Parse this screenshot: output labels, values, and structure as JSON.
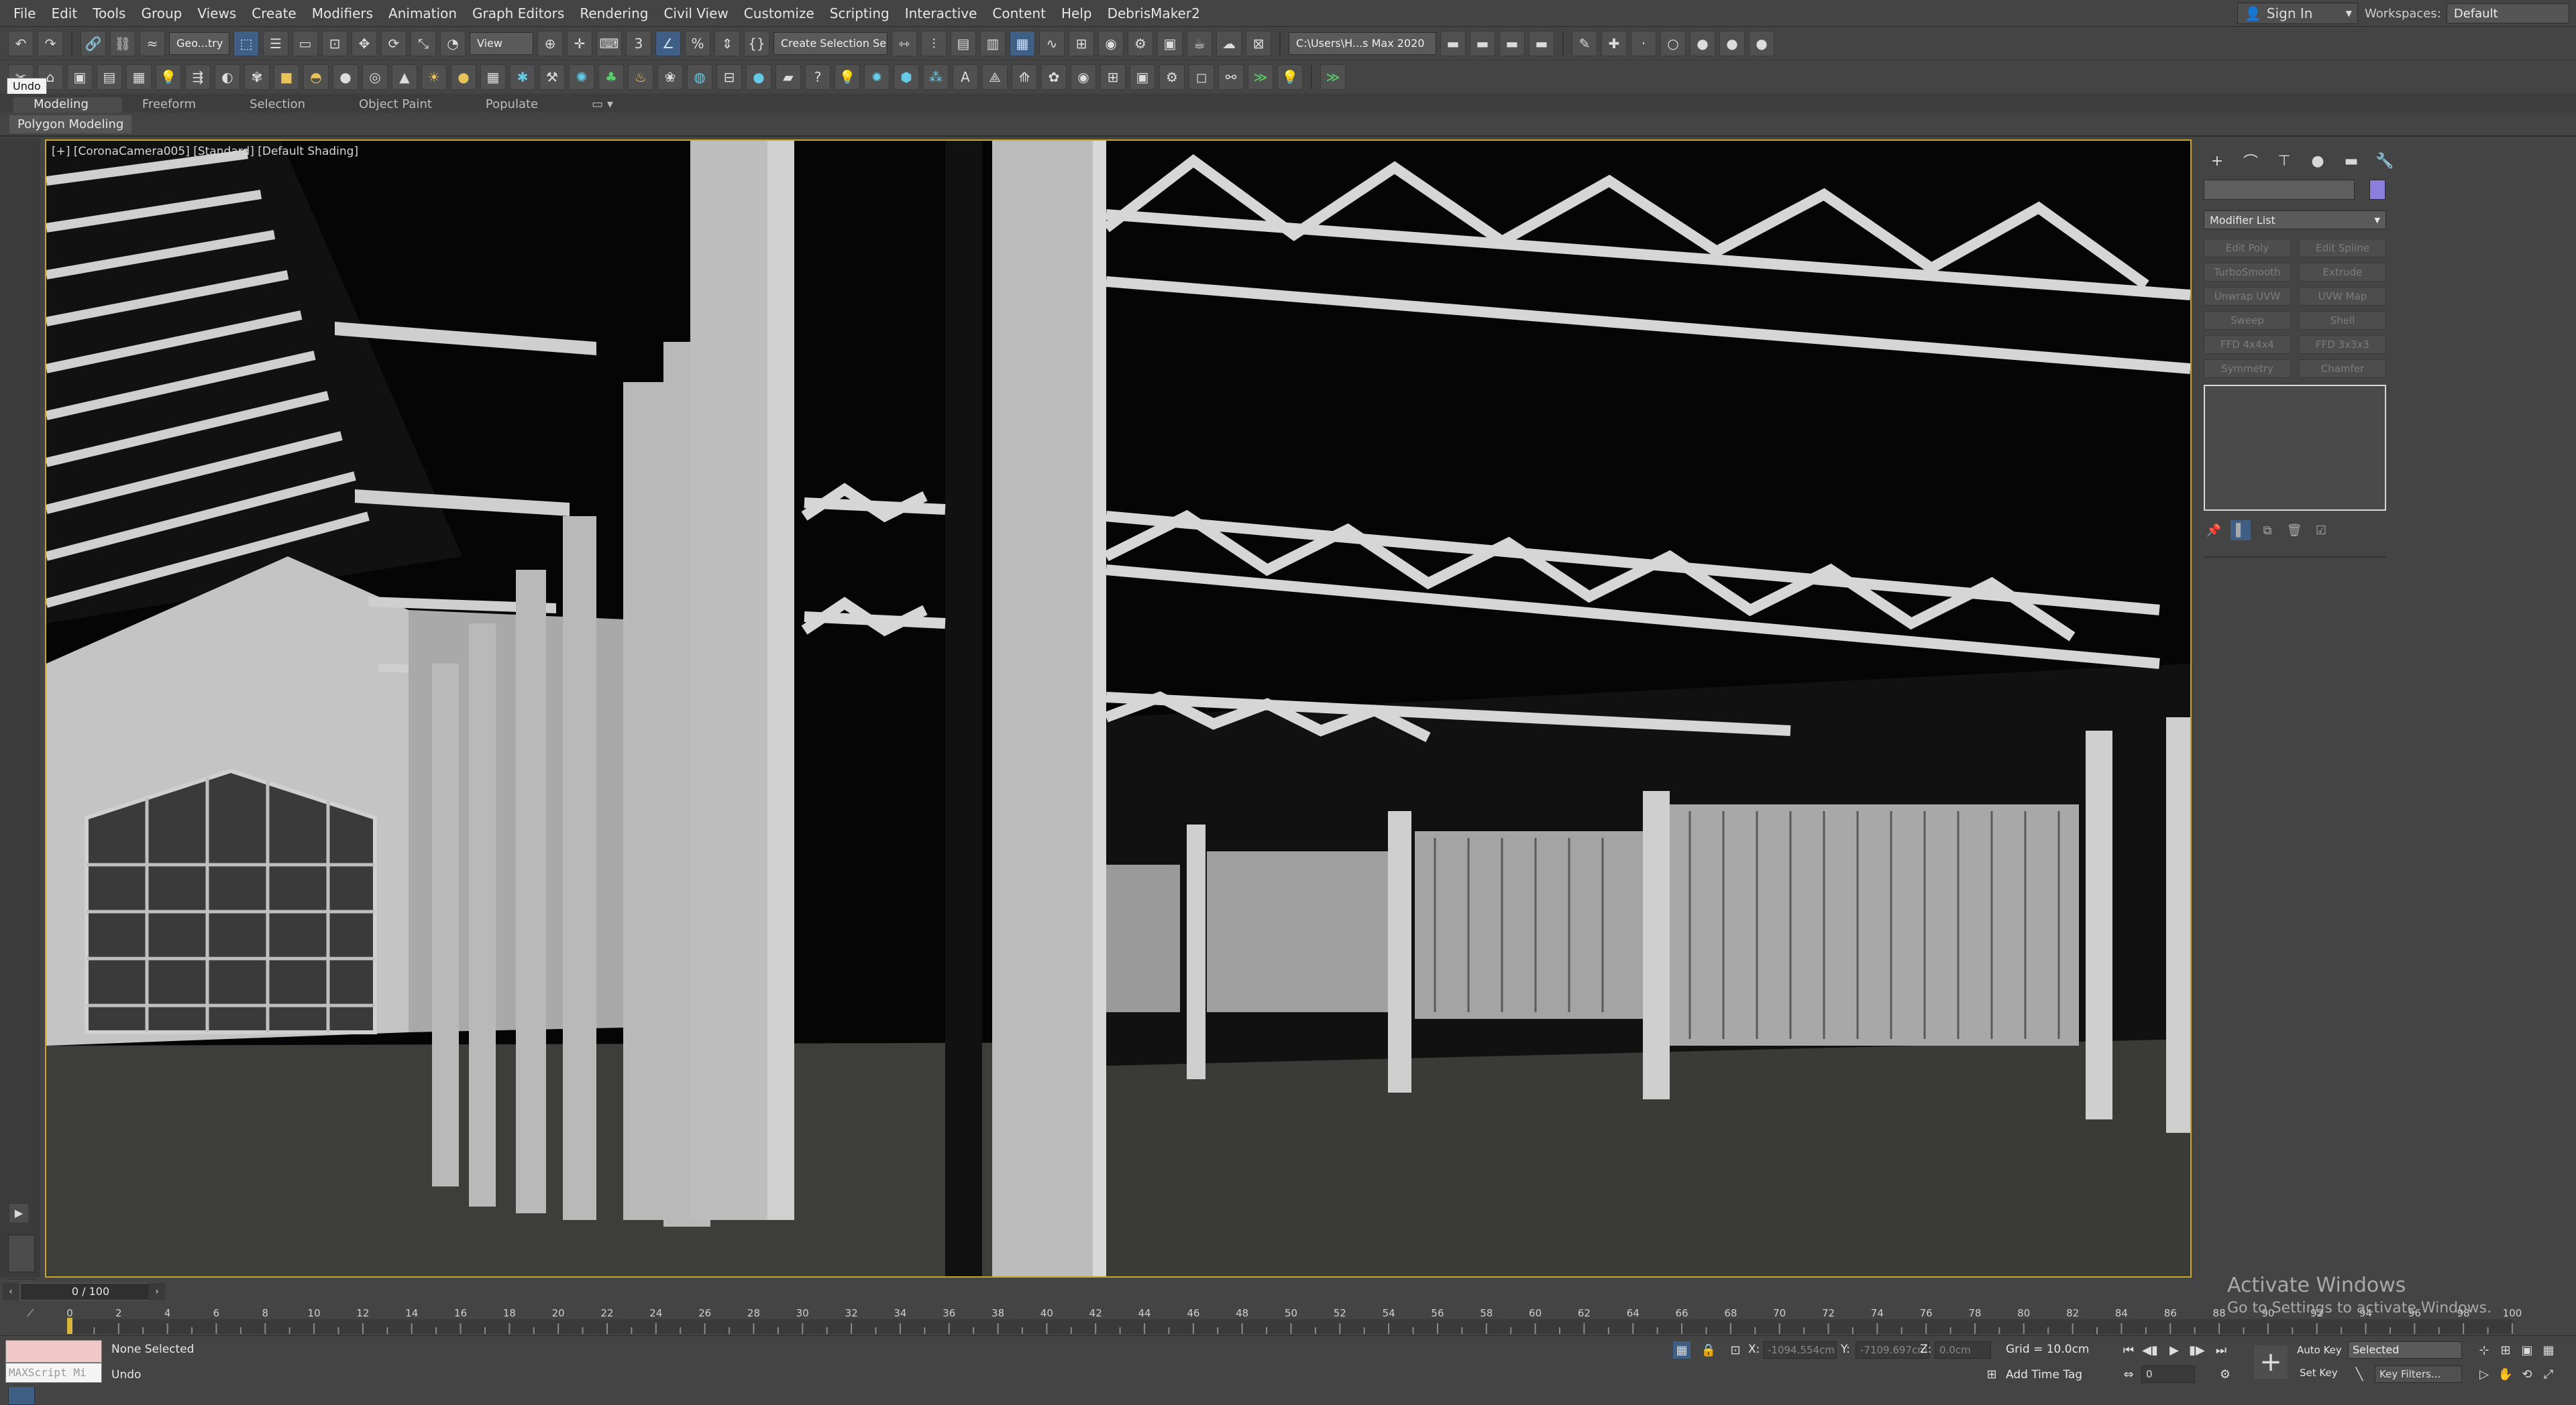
{
  "menu": [
    "File",
    "Edit",
    "Tools",
    "Group",
    "Views",
    "Create",
    "Modifiers",
    "Animation",
    "Graph Editors",
    "Rendering",
    "Civil View",
    "Customize",
    "Scripting",
    "Interactive",
    "Content",
    "Help",
    "DebrisMaker2"
  ],
  "account": {
    "signin_label": "Sign In",
    "workspaces_label": "Workspaces:",
    "workspace_value": "Default"
  },
  "toolbar": {
    "selection_filter": "Geo...try",
    "ref_coord": "View",
    "named_selection": "Create Selection Se",
    "project_path": "C:\\Users\\H...s Max 2020"
  },
  "tooltip": "Undo",
  "ribbon": {
    "tabs": [
      "Modeling",
      "Freeform",
      "Selection",
      "Object Paint",
      "Populate"
    ],
    "active_tab": "Modeling",
    "panel_label": "Polygon Modeling"
  },
  "viewport": {
    "label": "[+] [CoronaCamera005] [Standard] [Default Shading]"
  },
  "command_panel": {
    "modifier_list_label": "Modifier List",
    "color_swatch": "#8a7fdc",
    "modifier_buttons": [
      "Edit Poly",
      "Edit Spline",
      "TurboSmooth",
      "Extrude",
      "Unwrap UVW",
      "UVW Map",
      "Sweep",
      "Shell",
      "FFD 4x4x4",
      "FFD 3x3x3",
      "Symmetry",
      "Chamfer"
    ]
  },
  "timeline": {
    "frame_display": "0 / 100",
    "ticks": [
      0,
      2,
      4,
      6,
      8,
      10,
      12,
      14,
      16,
      18,
      20,
      22,
      24,
      26,
      28,
      30,
      32,
      34,
      36,
      38,
      40,
      42,
      44,
      46,
      48,
      50,
      52,
      54,
      56,
      58,
      60,
      62,
      64,
      66,
      68,
      70,
      72,
      74,
      76,
      78,
      80,
      82,
      84,
      86,
      88,
      90,
      92,
      94,
      96,
      98,
      100
    ],
    "current_frame": 0
  },
  "status": {
    "maxscript_label": "MAXScript Mi",
    "selection": "None Selected",
    "prompt": "Undo",
    "x_label": "X:",
    "x_value": "-1094.554cm",
    "y_label": "Y:",
    "y_value": "-7109.697cm",
    "z_label": "Z:",
    "z_value": "0.0cm",
    "grid": "Grid = 10.0cm",
    "add_time_tag": "Add Time Tag",
    "auto_key": "Auto Key",
    "set_key": "Set Key",
    "key_mode": "Selected",
    "key_filters": "Key Filters...",
    "frame_field": "0"
  },
  "watermark": {
    "title": "Activate Windows",
    "subtitle": "Go to Settings to activate Windows."
  }
}
